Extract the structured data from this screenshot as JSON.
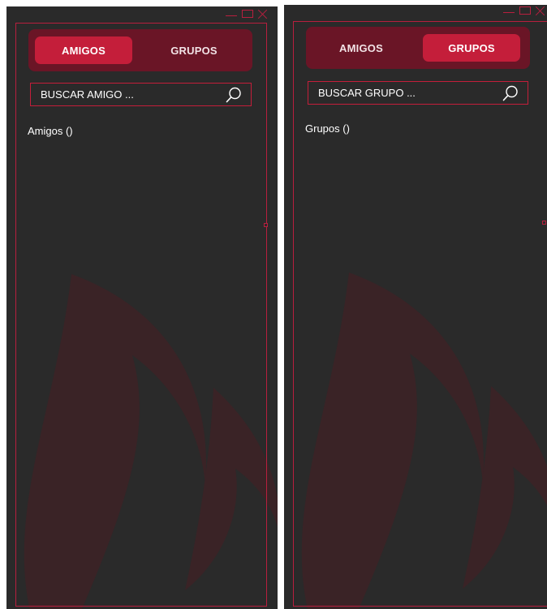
{
  "panels": [
    {
      "tabs": [
        {
          "label": "AMIGOS",
          "active": true
        },
        {
          "label": "GRUPOS",
          "active": false
        }
      ],
      "search": {
        "placeholder": "BUSCAR AMIGO ..."
      },
      "list_title": "Amigos ()"
    },
    {
      "tabs": [
        {
          "label": "AMIGOS",
          "active": false
        },
        {
          "label": "GRUPOS",
          "active": true
        }
      ],
      "search": {
        "placeholder": "BUSCAR GRUPO ..."
      },
      "list_title": "Grupos ()"
    }
  ],
  "colors": {
    "background": "#2a2a2a",
    "accent": "#c41e3a",
    "tab_bar": "#6a1526",
    "watermark": "#3a2326"
  },
  "icons": {
    "search": "search-icon",
    "minimize": "minimize-icon",
    "maximize": "maximize-icon",
    "close": "close-icon",
    "watermark": "flame-watermark-icon"
  }
}
